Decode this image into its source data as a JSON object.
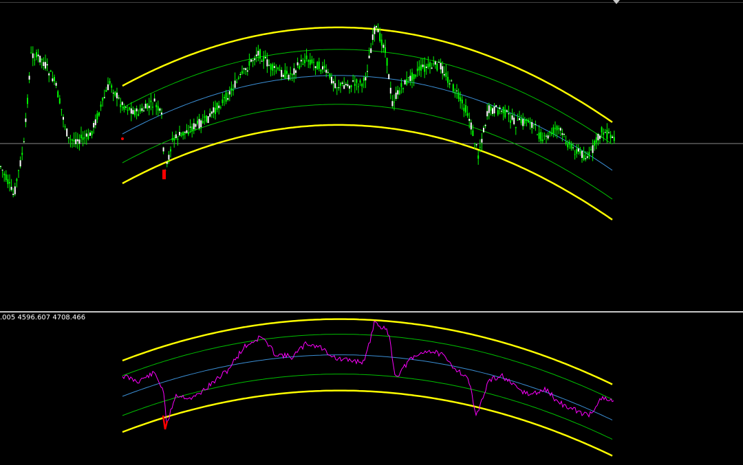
{
  "sub_window": {
    "values_label": ".005 4596.607 4708.466"
  },
  "colors": {
    "background": "#000000",
    "candle": "#00ff00",
    "candle_wick": "#ffffff",
    "outer_band": "#ffff00",
    "inner_band": "#00c000",
    "center_line": "#3b8fd6",
    "oscillator": "#ff00ff",
    "signal": "#ff0000",
    "price_line": "#8a8a8a",
    "separator": "#c8c8c8"
  },
  "chart_data": [
    {
      "type": "candlestick",
      "title": "",
      "xlabel": "",
      "ylabel": "",
      "grid": false,
      "ylim": [
        0,
        1
      ],
      "description_series": [
        {
          "name": "",
          "kind": "price",
          "shape": "uptrend then arc-range then decline"
        }
      ],
      "bands": {
        "kind": "parabolic regression channel",
        "lines": 5,
        "colors": [
          "#ffff00",
          "#00c000",
          "#3b8fd6",
          "#00c000",
          "#ffff00"
        ]
      },
      "current_price_level": 0.54
    },
    {
      "type": "line",
      "title": "",
      "xlabel": "",
      "ylabel": "",
      "grid": false,
      "values_label": ".005 4596.607 4708.466",
      "bands": {
        "kind": "parabolic regression channel",
        "lines": 5
      }
    }
  ]
}
